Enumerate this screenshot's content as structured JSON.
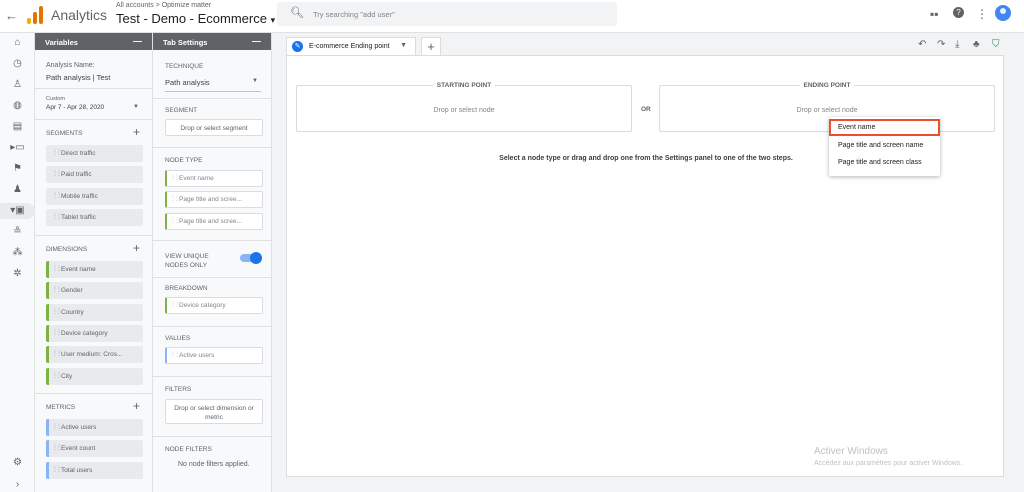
{
  "topbar": {
    "app_name": "Analytics",
    "breadcrumb": "All accounts > Optimize matter",
    "property": "Test - Demo - Ecommerce",
    "property_dropdown": "▾",
    "search_placeholder": "Try searching \"add user\"",
    "search_icon": "search-icon"
  },
  "variables": {
    "title": "Variables",
    "minimize": "—",
    "analysis_label": "Analysis Name:",
    "analysis_name": "Path analysis | Test",
    "date_label": "Custom",
    "date_range": "Apr 7 - Apr 28, 2020",
    "segments_label": "SEGMENTS",
    "segments": [
      "Direct traffic",
      "Paid traffic",
      "Mobile traffic",
      "Tablet traffic"
    ],
    "dimensions_label": "DIMENSIONS",
    "dimensions": [
      "Event name",
      "Gender",
      "Country",
      "Device category",
      "User medium: Cros...",
      "City"
    ],
    "metrics_label": "METRICS",
    "metrics": [
      "Active users",
      "Event count",
      "Total users"
    ]
  },
  "tab_settings": {
    "title": "Tab Settings",
    "minimize": "—",
    "technique_label": "TECHNIQUE",
    "technique": "Path analysis",
    "segment_label": "SEGMENT",
    "segment_drop": "Drop or select segment",
    "node_type_label": "NODE TYPE",
    "node_types": [
      "Event name",
      "Page title and scree...",
      "Page title and scree..."
    ],
    "view_unique_label": "VIEW UNIQUE NODES ONLY",
    "breakdown_label": "BREAKDOWN",
    "breakdown": "Device category",
    "values_label": "VALUES",
    "values": "Active users",
    "filters_label": "FILTERS",
    "filters_drop": "Drop or select dimension or metric",
    "node_filters_label": "NODE FILTERS",
    "node_filters_text": "No node filters applied."
  },
  "canvas": {
    "tab_label": "E-commerce Ending point",
    "add_tab": "+",
    "starting_title": "STARTING POINT",
    "starting_drop": "Drop or select node",
    "or": "OR",
    "ending_title": "ENDING POINT",
    "ending_drop": "Drop or select node",
    "helper": "Select a node type or drag and drop one from the Settings panel to one of the two steps.",
    "menu": [
      "Event name",
      "Page title and screen name",
      "Page title and screen class"
    ]
  },
  "watermark": {
    "title": "Activer Windows",
    "subtitle": "Accédez aux paramètres pour activer Windows."
  },
  "colors": {
    "accent": "#1a73e8",
    "highlight": "#e8502f",
    "dimension": "#7cb342",
    "metric": "#8ab4f8"
  }
}
